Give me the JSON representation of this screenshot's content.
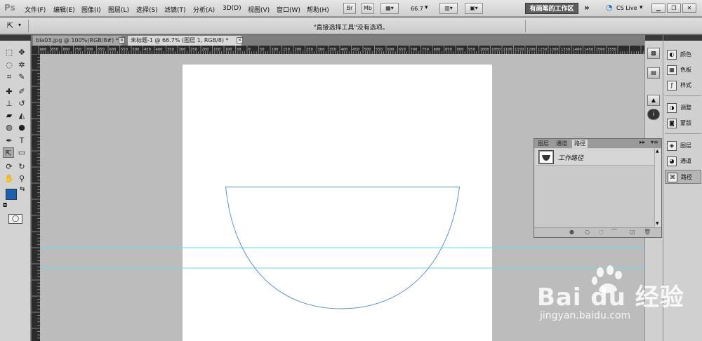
{
  "menubar": {
    "logo": "Ps",
    "menus": [
      "文件(F)",
      "编辑(E)",
      "图像(I)",
      "图层(L)",
      "选择(S)",
      "滤镜(T)",
      "分析(A)",
      "3D(D)",
      "视图(V)",
      "窗口(W)",
      "帮助(H)"
    ],
    "bridge_label": "Br",
    "minibridge_label": "Mb",
    "zoom_value": "66.7",
    "workspace_label": "有画笔的工作区",
    "cslive_label": "CS Live"
  },
  "options": {
    "message": "\"直接选择工具\"没有选项。"
  },
  "tabs": [
    {
      "label": "bla03.jpg @ 100%(RGB/8#) *"
    },
    {
      "label": "未标题-1 @ 66.7% (图层 1, RGB/8) *"
    }
  ],
  "ruler": {
    "top_ticks": [
      "900",
      "850",
      "800",
      "750",
      "700",
      "650",
      "600",
      "550",
      "500",
      "450",
      "400",
      "350",
      "300",
      "250",
      "200",
      "150",
      "100",
      "50",
      "0",
      "50",
      "100",
      "150",
      "200",
      "250",
      "300",
      "350",
      "400",
      "450",
      "500",
      "550",
      "600",
      "650",
      "700",
      "750",
      "800",
      "850",
      "900",
      "950",
      "1000",
      "1050",
      "1100",
      "1150",
      "1200",
      "1250",
      "1300",
      "1350",
      "1400",
      "1450",
      "1500",
      "1550"
    ]
  },
  "right_dock": {
    "items": [
      {
        "label": "颜色",
        "icon": "color-icon"
      },
      {
        "label": "色板",
        "icon": "swatches-icon"
      },
      {
        "label": "样式",
        "icon": "styles-icon"
      },
      {
        "label": "调整",
        "icon": "adjustments-icon"
      },
      {
        "label": "蒙版",
        "icon": "masks-icon"
      },
      {
        "label": "图层",
        "icon": "layers-icon"
      },
      {
        "label": "通道",
        "icon": "channels-icon"
      },
      {
        "label": "路径",
        "icon": "paths-icon"
      }
    ]
  },
  "paths_panel": {
    "tabs": [
      "图层",
      "通道",
      "路径"
    ],
    "active_tab": "路径",
    "rows": [
      {
        "label": "工作路径"
      }
    ]
  },
  "watermark": {
    "brand": "Bai du 经验",
    "url": "jingyan.baidu.com"
  },
  "colors": {
    "foreground": "#1a5fb4",
    "background": "#ffffff",
    "guide": "#5ee0ee",
    "path_stroke": "#5b8fd6"
  }
}
